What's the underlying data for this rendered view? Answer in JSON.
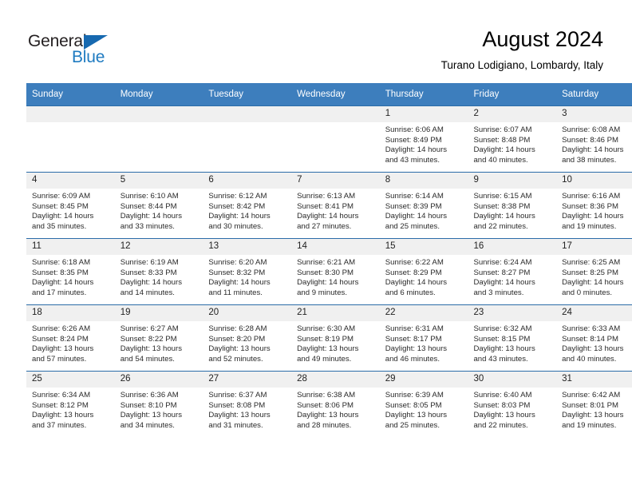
{
  "brand": {
    "name_part1": "General",
    "name_part2": "Blue",
    "triangle_color": "#1769b0",
    "text_color": "#231f20",
    "blue_color": "#1f7bc1"
  },
  "header": {
    "title": "August 2024",
    "subtitle": "Turano Lodigiano, Lombardy, Italy"
  },
  "theme": {
    "header_bg": "#3d7ebd",
    "daynum_bg": "#f0f0f0",
    "grid_line": "#2b6ca8"
  },
  "weekdays": [
    "Sunday",
    "Monday",
    "Tuesday",
    "Wednesday",
    "Thursday",
    "Friday",
    "Saturday"
  ],
  "weeks": [
    [
      {
        "day": "",
        "empty": true,
        "sunrise": "",
        "sunset": "",
        "daylight1": "",
        "daylight2": ""
      },
      {
        "day": "",
        "empty": true,
        "sunrise": "",
        "sunset": "",
        "daylight1": "",
        "daylight2": ""
      },
      {
        "day": "",
        "empty": true,
        "sunrise": "",
        "sunset": "",
        "daylight1": "",
        "daylight2": ""
      },
      {
        "day": "",
        "empty": true,
        "sunrise": "",
        "sunset": "",
        "daylight1": "",
        "daylight2": ""
      },
      {
        "day": "1",
        "empty": false,
        "sunrise": "Sunrise: 6:06 AM",
        "sunset": "Sunset: 8:49 PM",
        "daylight1": "Daylight: 14 hours",
        "daylight2": "and 43 minutes."
      },
      {
        "day": "2",
        "empty": false,
        "sunrise": "Sunrise: 6:07 AM",
        "sunset": "Sunset: 8:48 PM",
        "daylight1": "Daylight: 14 hours",
        "daylight2": "and 40 minutes."
      },
      {
        "day": "3",
        "empty": false,
        "sunrise": "Sunrise: 6:08 AM",
        "sunset": "Sunset: 8:46 PM",
        "daylight1": "Daylight: 14 hours",
        "daylight2": "and 38 minutes."
      }
    ],
    [
      {
        "day": "4",
        "empty": false,
        "sunrise": "Sunrise: 6:09 AM",
        "sunset": "Sunset: 8:45 PM",
        "daylight1": "Daylight: 14 hours",
        "daylight2": "and 35 minutes."
      },
      {
        "day": "5",
        "empty": false,
        "sunrise": "Sunrise: 6:10 AM",
        "sunset": "Sunset: 8:44 PM",
        "daylight1": "Daylight: 14 hours",
        "daylight2": "and 33 minutes."
      },
      {
        "day": "6",
        "empty": false,
        "sunrise": "Sunrise: 6:12 AM",
        "sunset": "Sunset: 8:42 PM",
        "daylight1": "Daylight: 14 hours",
        "daylight2": "and 30 minutes."
      },
      {
        "day": "7",
        "empty": false,
        "sunrise": "Sunrise: 6:13 AM",
        "sunset": "Sunset: 8:41 PM",
        "daylight1": "Daylight: 14 hours",
        "daylight2": "and 27 minutes."
      },
      {
        "day": "8",
        "empty": false,
        "sunrise": "Sunrise: 6:14 AM",
        "sunset": "Sunset: 8:39 PM",
        "daylight1": "Daylight: 14 hours",
        "daylight2": "and 25 minutes."
      },
      {
        "day": "9",
        "empty": false,
        "sunrise": "Sunrise: 6:15 AM",
        "sunset": "Sunset: 8:38 PM",
        "daylight1": "Daylight: 14 hours",
        "daylight2": "and 22 minutes."
      },
      {
        "day": "10",
        "empty": false,
        "sunrise": "Sunrise: 6:16 AM",
        "sunset": "Sunset: 8:36 PM",
        "daylight1": "Daylight: 14 hours",
        "daylight2": "and 19 minutes."
      }
    ],
    [
      {
        "day": "11",
        "empty": false,
        "sunrise": "Sunrise: 6:18 AM",
        "sunset": "Sunset: 8:35 PM",
        "daylight1": "Daylight: 14 hours",
        "daylight2": "and 17 minutes."
      },
      {
        "day": "12",
        "empty": false,
        "sunrise": "Sunrise: 6:19 AM",
        "sunset": "Sunset: 8:33 PM",
        "daylight1": "Daylight: 14 hours",
        "daylight2": "and 14 minutes."
      },
      {
        "day": "13",
        "empty": false,
        "sunrise": "Sunrise: 6:20 AM",
        "sunset": "Sunset: 8:32 PM",
        "daylight1": "Daylight: 14 hours",
        "daylight2": "and 11 minutes."
      },
      {
        "day": "14",
        "empty": false,
        "sunrise": "Sunrise: 6:21 AM",
        "sunset": "Sunset: 8:30 PM",
        "daylight1": "Daylight: 14 hours",
        "daylight2": "and 9 minutes."
      },
      {
        "day": "15",
        "empty": false,
        "sunrise": "Sunrise: 6:22 AM",
        "sunset": "Sunset: 8:29 PM",
        "daylight1": "Daylight: 14 hours",
        "daylight2": "and 6 minutes."
      },
      {
        "day": "16",
        "empty": false,
        "sunrise": "Sunrise: 6:24 AM",
        "sunset": "Sunset: 8:27 PM",
        "daylight1": "Daylight: 14 hours",
        "daylight2": "and 3 minutes."
      },
      {
        "day": "17",
        "empty": false,
        "sunrise": "Sunrise: 6:25 AM",
        "sunset": "Sunset: 8:25 PM",
        "daylight1": "Daylight: 14 hours",
        "daylight2": "and 0 minutes."
      }
    ],
    [
      {
        "day": "18",
        "empty": false,
        "sunrise": "Sunrise: 6:26 AM",
        "sunset": "Sunset: 8:24 PM",
        "daylight1": "Daylight: 13 hours",
        "daylight2": "and 57 minutes."
      },
      {
        "day": "19",
        "empty": false,
        "sunrise": "Sunrise: 6:27 AM",
        "sunset": "Sunset: 8:22 PM",
        "daylight1": "Daylight: 13 hours",
        "daylight2": "and 54 minutes."
      },
      {
        "day": "20",
        "empty": false,
        "sunrise": "Sunrise: 6:28 AM",
        "sunset": "Sunset: 8:20 PM",
        "daylight1": "Daylight: 13 hours",
        "daylight2": "and 52 minutes."
      },
      {
        "day": "21",
        "empty": false,
        "sunrise": "Sunrise: 6:30 AM",
        "sunset": "Sunset: 8:19 PM",
        "daylight1": "Daylight: 13 hours",
        "daylight2": "and 49 minutes."
      },
      {
        "day": "22",
        "empty": false,
        "sunrise": "Sunrise: 6:31 AM",
        "sunset": "Sunset: 8:17 PM",
        "daylight1": "Daylight: 13 hours",
        "daylight2": "and 46 minutes."
      },
      {
        "day": "23",
        "empty": false,
        "sunrise": "Sunrise: 6:32 AM",
        "sunset": "Sunset: 8:15 PM",
        "daylight1": "Daylight: 13 hours",
        "daylight2": "and 43 minutes."
      },
      {
        "day": "24",
        "empty": false,
        "sunrise": "Sunrise: 6:33 AM",
        "sunset": "Sunset: 8:14 PM",
        "daylight1": "Daylight: 13 hours",
        "daylight2": "and 40 minutes."
      }
    ],
    [
      {
        "day": "25",
        "empty": false,
        "sunrise": "Sunrise: 6:34 AM",
        "sunset": "Sunset: 8:12 PM",
        "daylight1": "Daylight: 13 hours",
        "daylight2": "and 37 minutes."
      },
      {
        "day": "26",
        "empty": false,
        "sunrise": "Sunrise: 6:36 AM",
        "sunset": "Sunset: 8:10 PM",
        "daylight1": "Daylight: 13 hours",
        "daylight2": "and 34 minutes."
      },
      {
        "day": "27",
        "empty": false,
        "sunrise": "Sunrise: 6:37 AM",
        "sunset": "Sunset: 8:08 PM",
        "daylight1": "Daylight: 13 hours",
        "daylight2": "and 31 minutes."
      },
      {
        "day": "28",
        "empty": false,
        "sunrise": "Sunrise: 6:38 AM",
        "sunset": "Sunset: 8:06 PM",
        "daylight1": "Daylight: 13 hours",
        "daylight2": "and 28 minutes."
      },
      {
        "day": "29",
        "empty": false,
        "sunrise": "Sunrise: 6:39 AM",
        "sunset": "Sunset: 8:05 PM",
        "daylight1": "Daylight: 13 hours",
        "daylight2": "and 25 minutes."
      },
      {
        "day": "30",
        "empty": false,
        "sunrise": "Sunrise: 6:40 AM",
        "sunset": "Sunset: 8:03 PM",
        "daylight1": "Daylight: 13 hours",
        "daylight2": "and 22 minutes."
      },
      {
        "day": "31",
        "empty": false,
        "sunrise": "Sunrise: 6:42 AM",
        "sunset": "Sunset: 8:01 PM",
        "daylight1": "Daylight: 13 hours",
        "daylight2": "and 19 minutes."
      }
    ]
  ]
}
